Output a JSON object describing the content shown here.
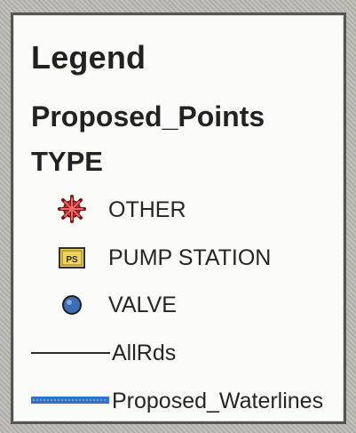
{
  "legend": {
    "title": "Legend",
    "layer_title": "Proposed_Points",
    "field_title": "TYPE",
    "items": [
      {
        "label": "OTHER",
        "icon": "asterisk-marker-icon",
        "color": "#d94b4b"
      },
      {
        "label": "PUMP STATION",
        "icon": "pump-station-marker-icon",
        "symbol_text": "PS",
        "color": "#f0d35a"
      },
      {
        "label": "VALVE",
        "icon": "valve-circle-icon",
        "color": "#3e6fb6"
      },
      {
        "label": "AllRds",
        "icon": "road-line-icon",
        "color": "#2c2c2c"
      },
      {
        "label": "Proposed_Waterlines",
        "icon": "waterline-icon",
        "color": "#2f72c8"
      }
    ]
  }
}
